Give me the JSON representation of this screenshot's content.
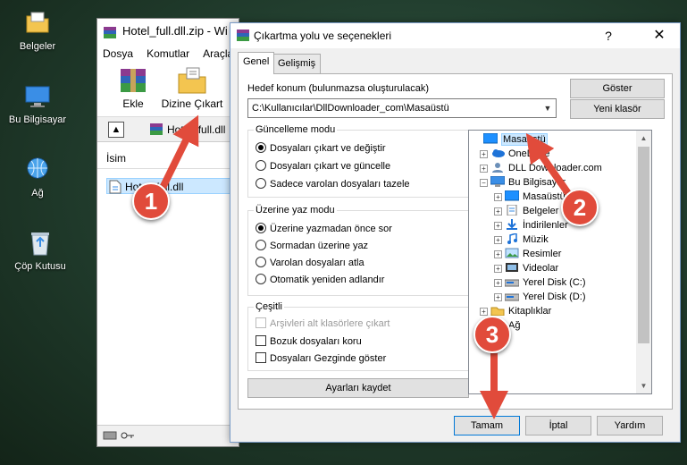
{
  "colors": {
    "accent": "#0078d7",
    "marker": "#e14b3b",
    "selection": "#cce8ff",
    "folder": "#f3c550"
  },
  "desktop": {
    "icons": [
      {
        "label": "Belgeler",
        "icon": "documents-folder-icon"
      },
      {
        "label": "Bu Bilgisayar",
        "icon": "computer-icon"
      },
      {
        "label": "Ağ",
        "icon": "network-icon"
      },
      {
        "label": "Çöp Kutusu",
        "icon": "recycle-bin-icon"
      }
    ]
  },
  "winrar": {
    "title": "Hotel_full.dll.zip - Wi",
    "menu": [
      "Dosya",
      "Komutlar",
      "Araçla"
    ],
    "toolbar": {
      "add": "Ekle",
      "extract": "Dizine Çıkart"
    },
    "path": "Hotel_full.dll",
    "list_header": "İsim",
    "file": "Hotel_full.dll"
  },
  "dialog": {
    "title": "Çıkartma yolu ve seçenekleri",
    "help": "?",
    "close": "✕",
    "tabs": [
      "Genel",
      "Gelişmiş"
    ],
    "dest_label": "Hedef konum (bulunmazsa oluşturulacak)",
    "dest_value": "C:\\Kullanıcılar\\DllDownloader_com\\Masaüstü",
    "show_button": "Göster",
    "new_folder_button": "Yeni klasör",
    "update_group": {
      "title": "Güncelleme modu",
      "options": [
        "Dosyaları çıkart ve değiştir",
        "Dosyaları çıkart ve güncelle",
        "Sadece varolan dosyaları tazele"
      ],
      "selected": 0
    },
    "overwrite_group": {
      "title": "Üzerine yaz modu",
      "options": [
        "Üzerine yazmadan önce sor",
        "Sormadan üzerine yaz",
        "Varolan dosyaları atla",
        "Otomatik yeniden adlandır"
      ],
      "selected": 0
    },
    "misc_group": {
      "title": "Çeşitli",
      "options": [
        "Arşivleri alt klasörlere çıkart",
        "Bozuk dosyaları koru",
        "Dosyaları Gezginde göster"
      ]
    },
    "save_settings": "Ayarları kaydet",
    "tree": [
      {
        "label": "Masaüstü",
        "indent": 0,
        "icon": "desktop-icon",
        "expander": "",
        "selected": true
      },
      {
        "label": "OneDrive",
        "indent": 1,
        "icon": "cloud-icon",
        "expander": "+"
      },
      {
        "label": "DLL Downloader.com",
        "indent": 1,
        "icon": "user-folder-icon",
        "expander": "+"
      },
      {
        "label": "Bu Bilgisayar",
        "indent": 1,
        "icon": "computer-icon",
        "expander": "−"
      },
      {
        "label": "Masaüstü",
        "indent": 2,
        "icon": "desktop-icon",
        "expander": "+"
      },
      {
        "label": "Belgeler",
        "indent": 2,
        "icon": "documents-icon",
        "expander": "+"
      },
      {
        "label": "İndirilenler",
        "indent": 2,
        "icon": "downloads-icon",
        "expander": "+"
      },
      {
        "label": "Müzik",
        "indent": 2,
        "icon": "music-icon",
        "expander": "+"
      },
      {
        "label": "Resimler",
        "indent": 2,
        "icon": "pictures-icon",
        "expander": "+"
      },
      {
        "label": "Videolar",
        "indent": 2,
        "icon": "videos-icon",
        "expander": "+"
      },
      {
        "label": "Yerel Disk (C:)",
        "indent": 2,
        "icon": "drive-icon",
        "expander": "+"
      },
      {
        "label": "Yerel Disk (D:)",
        "indent": 2,
        "icon": "drive-icon",
        "expander": "+"
      },
      {
        "label": "Kitaplıklar",
        "indent": 1,
        "icon": "libraries-icon",
        "expander": "+"
      },
      {
        "label": "Ağ",
        "indent": 1,
        "icon": "network-icon",
        "expander": "+"
      }
    ],
    "buttons": {
      "ok": "Tamam",
      "cancel": "İptal",
      "help": "Yardım"
    }
  },
  "annotations": [
    "1",
    "2",
    "3"
  ]
}
